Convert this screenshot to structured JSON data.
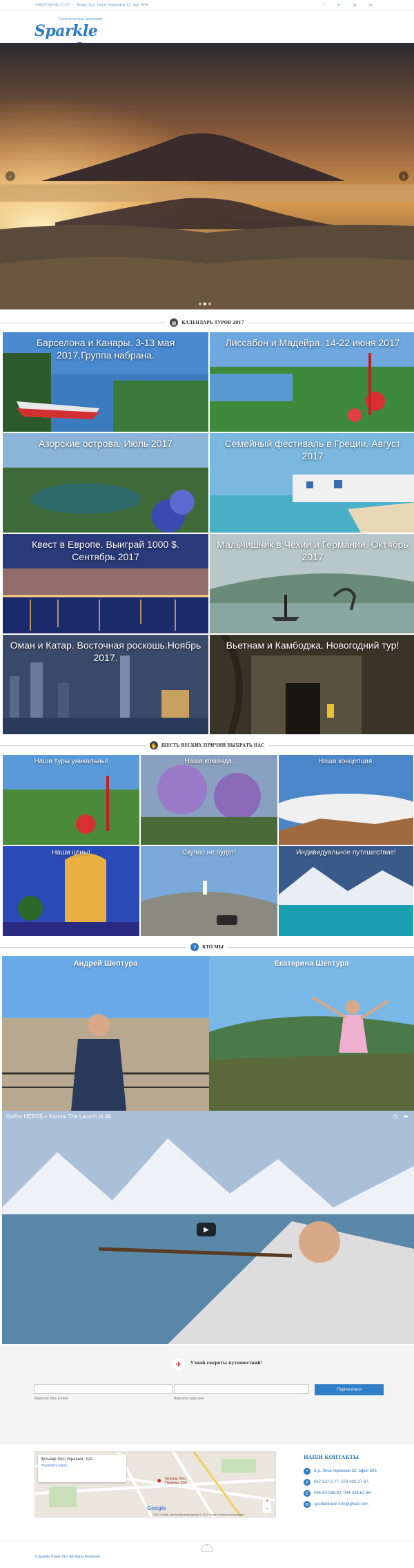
{
  "topbar": {
    "phone": "+38(073)000-27-97",
    "address": "Киев, б-р. Леси Украинки 32, оф. 505",
    "social": [
      "f",
      "in",
      "ig",
      "vk"
    ]
  },
  "logo": {
    "tagline": "Туристическая компания",
    "name": "Sparkle travel"
  },
  "hero": {
    "prev": "‹",
    "next": "›"
  },
  "sections": {
    "calendar": "КАЛЕНДАРЬ ТУРОВ 2017",
    "reasons": "ШЕСТЬ ВЕСКИХ ПРИЧИН ВЫБРАТЬ НАС",
    "who": "КТО МЫ"
  },
  "tours": [
    "Барселона и Канары. 3-13 мая 2017.Группа набрана.",
    "Лиссабон и Мадейра. 14-22 июня 2017",
    "Азорские острова. Июль 2017",
    "Семейный фестиваль в Греции. Август 2017",
    "Квест в Европе. Выиграй 1000 $. Сентябрь 2017",
    "Мальчишник в Чехии и Германии. Октябрь 2017",
    "Оман и Катар. Восточная роскошь.Ноябрь 2017.",
    "Вьетнам и Камбоджа. Новогодний тур!"
  ],
  "reasons": [
    "Наши туры уникальны!",
    "Наша команда.",
    "Наша концепция.",
    "Наши цены!",
    "Скучно не будет!",
    "Индивидуальное путешествие!"
  ],
  "team": [
    "Андрей Шептура",
    "Екатерина Шептура"
  ],
  "video": {
    "title": "GoPro HERO5 + Karma: The Launch in 4K",
    "play": "▶"
  },
  "subscribe": {
    "heading": "Узнай секреты путешествий!",
    "email_label": "Введите Ваш E-mail",
    "name_label": "Введите свое имя",
    "button": "Подписаться"
  },
  "map": {
    "card_title": "бульвар Лесі Українки, 32А",
    "card_link": "Увеличить карту",
    "marker_label": "бульвар Лесі Українки, 32А",
    "google": "Google",
    "copyright": "©2017 Google, Картографические данные © 2017 Google   Условия использования"
  },
  "contacts": {
    "title": "НАШИ КОНТАКТЫ",
    "address": "б-р. Леси Украинки 32, офис 505",
    "phones1": "067-337-0-77, 073-000-27-97,",
    "phones2": "095-93-098-82, 044-338-62-86",
    "email": "sparkletravel.info@gmail.com"
  },
  "footer": {
    "copyright": "© Sparkle Travel 2017 All Rights Reserved",
    "up": "^"
  }
}
